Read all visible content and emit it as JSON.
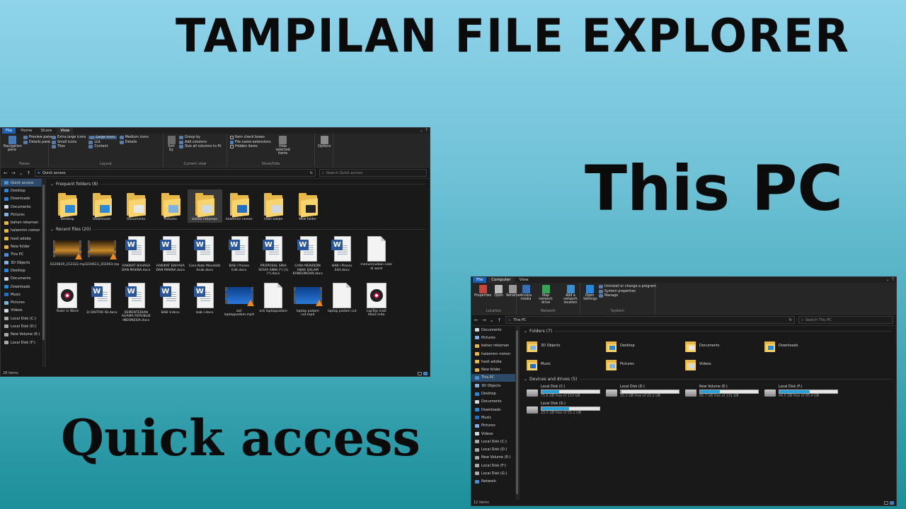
{
  "headings": {
    "main": "TAMPILAN FILE EXPLORER",
    "this_pc": "This PC",
    "quick_access": "Quick access"
  },
  "colors": {
    "accent": "#1a5fb4",
    "folder": "#e6b84a",
    "drive_fill": "#26a0da"
  },
  "qa": {
    "tabs": [
      "File",
      "Home",
      "Share",
      "View"
    ],
    "ribbon": {
      "panes": {
        "nav_pane": "Navigation pane",
        "preview_pane": "Preview pane",
        "details_pane": "Details pane",
        "label": "Panes"
      },
      "layout": {
        "items": [
          "Extra large icons",
          "Large icons",
          "Medium icons",
          "Small icons",
          "List",
          "Details",
          "Tiles",
          "Content"
        ],
        "selected": "Large icons",
        "label": "Layout"
      },
      "current_view": {
        "sort": "Sort by",
        "group_by": "Group by",
        "add_columns": "Add columns",
        "size_all": "Size all columns to fit",
        "label": "Current view"
      },
      "show_hide": {
        "item_check": "Item check boxes",
        "extensions": "File name extensions",
        "hidden": "Hidden items",
        "hide_selected": "Hide selected items",
        "label": "Show/hide"
      },
      "options": "Options"
    },
    "address": "Quick access",
    "search_placeholder": "Search Quick access",
    "nav": [
      "Quick access",
      "Desktop",
      "Downloads",
      "Documents",
      "Pictures",
      "bahan rekaman",
      "halammn nomor",
      "hasil adobe",
      "New folder",
      "This PC",
      "3D Objects",
      "Desktop",
      "Documents",
      "Downloads",
      "Music",
      "Pictures",
      "Videos",
      "Local Disk (C:)",
      "Local Disk (D:)",
      "New Volume (E:)",
      "Local Disk (F:)"
    ],
    "frequent_header": "Frequent folders (8)",
    "frequent": [
      {
        "name": "Desktop",
        "badge": "#2b88d8"
      },
      {
        "name": "Downloads",
        "badge": "#2b88d8"
      },
      {
        "name": "Documents",
        "badge": "#e8e8e8"
      },
      {
        "name": "Pictures",
        "badge": "#7fb2e0"
      },
      {
        "name": "bahan rekaman",
        "badge": "#cfd8e3"
      },
      {
        "name": "halammn nomor",
        "badge": "#1f6fc5"
      },
      {
        "name": "hasil adobe",
        "badge": "#cfd8e3"
      },
      {
        "name": "New folder",
        "badge": "#222"
      }
    ],
    "recent_header": "Recent files (20)",
    "recent": [
      {
        "name": "20220629_212322.mp4",
        "kind": "vid"
      },
      {
        "name": "20220613_202003.mp4",
        "kind": "vid"
      },
      {
        "name": "HAKIKAT BAHASA DAN MAKNA.docx",
        "kind": "doc"
      },
      {
        "name": "HAKIKAT BAHASA DAN MAKNA.docx",
        "kind": "doc"
      },
      {
        "name": "Cara Nabi Mendidik Anak.docx",
        "kind": "doc"
      },
      {
        "name": "BAB I Proses Edit.docx",
        "kind": "doc"
      },
      {
        "name": "PROPOSAL SINA SOVIA ANNI (*) (1) (*).docx",
        "kind": "doc"
      },
      {
        "name": "CARA MENDIDIK ANAK DALAM KANDUNGAN.docx",
        "kind": "doc"
      },
      {
        "name": "BAB I Proses Edit.docx",
        "kind": "doc"
      },
      {
        "name": "menumculkan ruler di word",
        "kind": "blank"
      },
      {
        "name": "Ruler in Word",
        "kind": "disc"
      },
      {
        "name": "3) DAFTAR ISI.docx",
        "kind": "doc"
      },
      {
        "name": "KEMENTERIAN AGAMA REPUBLIK INDONESIA.docx",
        "kind": "doc"
      },
      {
        "name": "BAB V.docx",
        "kind": "doc"
      },
      {
        "name": "bab I.docx",
        "kind": "doc"
      },
      {
        "name": "asli laptoppadam.mp4",
        "kind": "vid2"
      },
      {
        "name": "asli laptoppadam",
        "kind": "blank"
      },
      {
        "name": "laptop padam cut.mp4",
        "kind": "vid2"
      },
      {
        "name": "laptop padam cut",
        "kind": "blank"
      },
      {
        "name": "LapTop mati tiba2.m4a",
        "kind": "disc"
      }
    ],
    "status": "28 items"
  },
  "pc": {
    "tabs": [
      "File",
      "Computer",
      "View"
    ],
    "ribbon": {
      "location": [
        "Properties",
        "Open",
        "Rename"
      ],
      "location_label": "Location",
      "network": [
        "Access media",
        "Map network drive",
        "Add a network location"
      ],
      "network_label": "Network",
      "open_settings": "Open Settings",
      "system": [
        "Uninstall or change a program",
        "System properties",
        "Manage"
      ],
      "system_label": "System"
    },
    "address": "This PC",
    "search_placeholder": "Search This PC",
    "nav": [
      "Documents",
      "Pictures",
      "bahan rekaman",
      "halammn nomor",
      "hasil adobe",
      "New folder",
      "This PC",
      "3D Objects",
      "Desktop",
      "Documents",
      "Downloads",
      "Music",
      "Pictures",
      "Videos",
      "Local Disk (C:)",
      "Local Disk (D:)",
      "New Volume (E:)",
      "Local Disk (F:)",
      "Local Disk (G:)",
      "Network"
    ],
    "folders_header": "Folders (7)",
    "folders": [
      {
        "name": "3D Objects",
        "badge": "#7fb2e0"
      },
      {
        "name": "Desktop",
        "badge": "#2b88d8"
      },
      {
        "name": "Documents",
        "badge": "#e8e8e8"
      },
      {
        "name": "Downloads",
        "badge": "#2b88d8"
      },
      {
        "name": "Music",
        "badge": "#1f6fc5"
      },
      {
        "name": "Pictures",
        "badge": "#7fb2e0"
      },
      {
        "name": "Videos",
        "badge": "#cfd8e3"
      }
    ],
    "drives_header": "Devices and drives (5)",
    "drives": [
      {
        "name": "Local Disk (C:)",
        "free": "75.6 GB free of 110 GB",
        "used_fraction": 0.31
      },
      {
        "name": "Local Disk (D:)",
        "free": "20.1 GB free of 20.2 GB",
        "used_fraction": 0.01
      },
      {
        "name": "New Volume (E:)",
        "free": "86.7 GB free of 131 GB",
        "used_fraction": 0.34
      },
      {
        "name": "Local Disk (F:)",
        "free": "44.5 GB free of 95.4 GB",
        "used_fraction": 0.53
      },
      {
        "name": "Local Disk (G:)",
        "free": "29.5 GB free of 55.2 GB",
        "used_fraction": 0.47
      }
    ],
    "status": "12 items"
  }
}
